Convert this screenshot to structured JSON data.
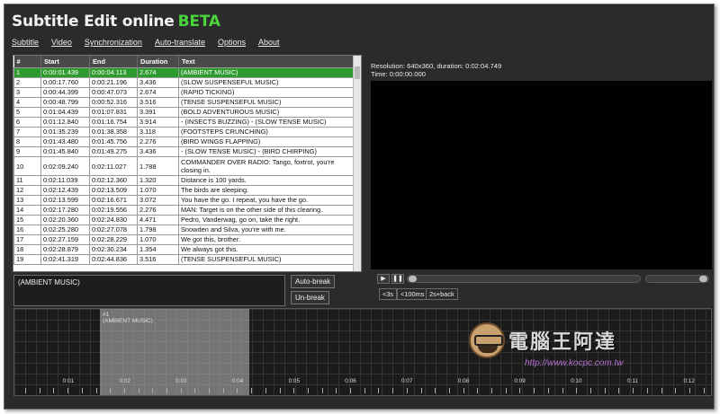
{
  "app": {
    "title": "Subtitle Edit online",
    "beta": "BETA"
  },
  "menu": [
    "Subtitle",
    "Video",
    "Synchronization",
    "Auto-translate",
    "Options",
    "About"
  ],
  "grid": {
    "headers": [
      "#",
      "Start",
      "End",
      "Duration",
      "Text"
    ],
    "rows": [
      {
        "n": "1",
        "start": "0:00:01.439",
        "end": "0:00:04.113",
        "dur": "2.674",
        "text": "(AMBIENT MUSIC)"
      },
      {
        "n": "2",
        "start": "0:00:17.760",
        "end": "0:00:21.196",
        "dur": "3.436",
        "text": "(SLOW SUSPENSEFUL MUSIC)"
      },
      {
        "n": "3",
        "start": "0:00:44.399",
        "end": "0:00:47.073",
        "dur": "2.674",
        "text": "(RAPID TICKING)"
      },
      {
        "n": "4",
        "start": "0:00:48.799",
        "end": "0:00:52.316",
        "dur": "3.516",
        "text": "(TENSE SUSPENSEFUL MUSIC)"
      },
      {
        "n": "5",
        "start": "0:01:04.439",
        "end": "0:01:07.831",
        "dur": "3.391",
        "text": "(BOLD ADVENTUROUS MUSIC)"
      },
      {
        "n": "6",
        "start": "0:01:12.840",
        "end": "0:01:16.754",
        "dur": "3.914",
        "text": "- (INSECTS BUZZING) - (SLOW TENSE MUSIC)"
      },
      {
        "n": "7",
        "start": "0:01:35.239",
        "end": "0:01:38.358",
        "dur": "3.118",
        "text": "(FOOTSTEPS CRUNCHING)"
      },
      {
        "n": "8",
        "start": "0:01:43.480",
        "end": "0:01:45.756",
        "dur": "2.276",
        "text": "(BIRD WINGS FLAPPING)"
      },
      {
        "n": "9",
        "start": "0:01:45.840",
        "end": "0:01:49.275",
        "dur": "3.436",
        "text": "- (SLOW TENSE MUSIC) - (BIRD CHIRPING)"
      },
      {
        "n": "10",
        "start": "0:02:09.240",
        "end": "0:02:11.027",
        "dur": "1.788",
        "text": "COMMANDER OVER RADIO: Tango, foxtrot, you're closing in."
      },
      {
        "n": "11",
        "start": "0:02:11.039",
        "end": "0:02:12.360",
        "dur": "1.320",
        "text": "Distance is 100 yards."
      },
      {
        "n": "12",
        "start": "0:02:12.439",
        "end": "0:02:13.509",
        "dur": "1.070",
        "text": "The birds are sleeping."
      },
      {
        "n": "13",
        "start": "0:02:13.599",
        "end": "0:02:16.671",
        "dur": "3.072",
        "text": "You have the go. I repeat, you have the go."
      },
      {
        "n": "14",
        "start": "0:02:17.280",
        "end": "0:02:19.556",
        "dur": "2.276",
        "text": "MAN: Target is on the other side of this clearing."
      },
      {
        "n": "15",
        "start": "0:02:20.360",
        "end": "0:02:24.830",
        "dur": "4.471",
        "text": "Pedro, Vanderwag, go on, take the right."
      },
      {
        "n": "16",
        "start": "0:02:25.280",
        "end": "0:02:27.078",
        "dur": "1.798",
        "text": "Snowden and Silva, you're with me."
      },
      {
        "n": "17",
        "start": "0:02:27.159",
        "end": "0:02:28.229",
        "dur": "1.070",
        "text": "We got this, brother."
      },
      {
        "n": "18",
        "start": "0:02:28.879",
        "end": "0:02:30.234",
        "dur": "1.354",
        "text": "We always got this."
      },
      {
        "n": "19",
        "start": "0:02:41.319",
        "end": "0:02:44.836",
        "dur": "3.516",
        "text": "(TENSE SUSPENSEFUL MUSIC)"
      }
    ]
  },
  "editor": {
    "text": "(AMBIENT MUSIC)",
    "auto_break": "Auto-break",
    "un_break": "Un-break"
  },
  "video": {
    "resolution": "Resolution: 640x360, duration: 0:02:04.749",
    "time": "Time: 0:00:00.000",
    "play_icon": "▶",
    "pause_icon": "❚❚",
    "skip": [
      "<3s",
      "<100ms",
      "2s+back"
    ]
  },
  "waveform": {
    "segment_label": "#1",
    "segment_text": "(AMBIENT MUSIC)",
    "ticks": [
      "0:01",
      "0:02",
      "0:03",
      "0:04",
      "0:05",
      "0:06",
      "0:07",
      "0:08",
      "0:09",
      "0:10",
      "0:11",
      "0:12"
    ]
  },
  "watermark": {
    "text": "電腦王阿達",
    "url": "http://www.kocpc.com.tw"
  }
}
